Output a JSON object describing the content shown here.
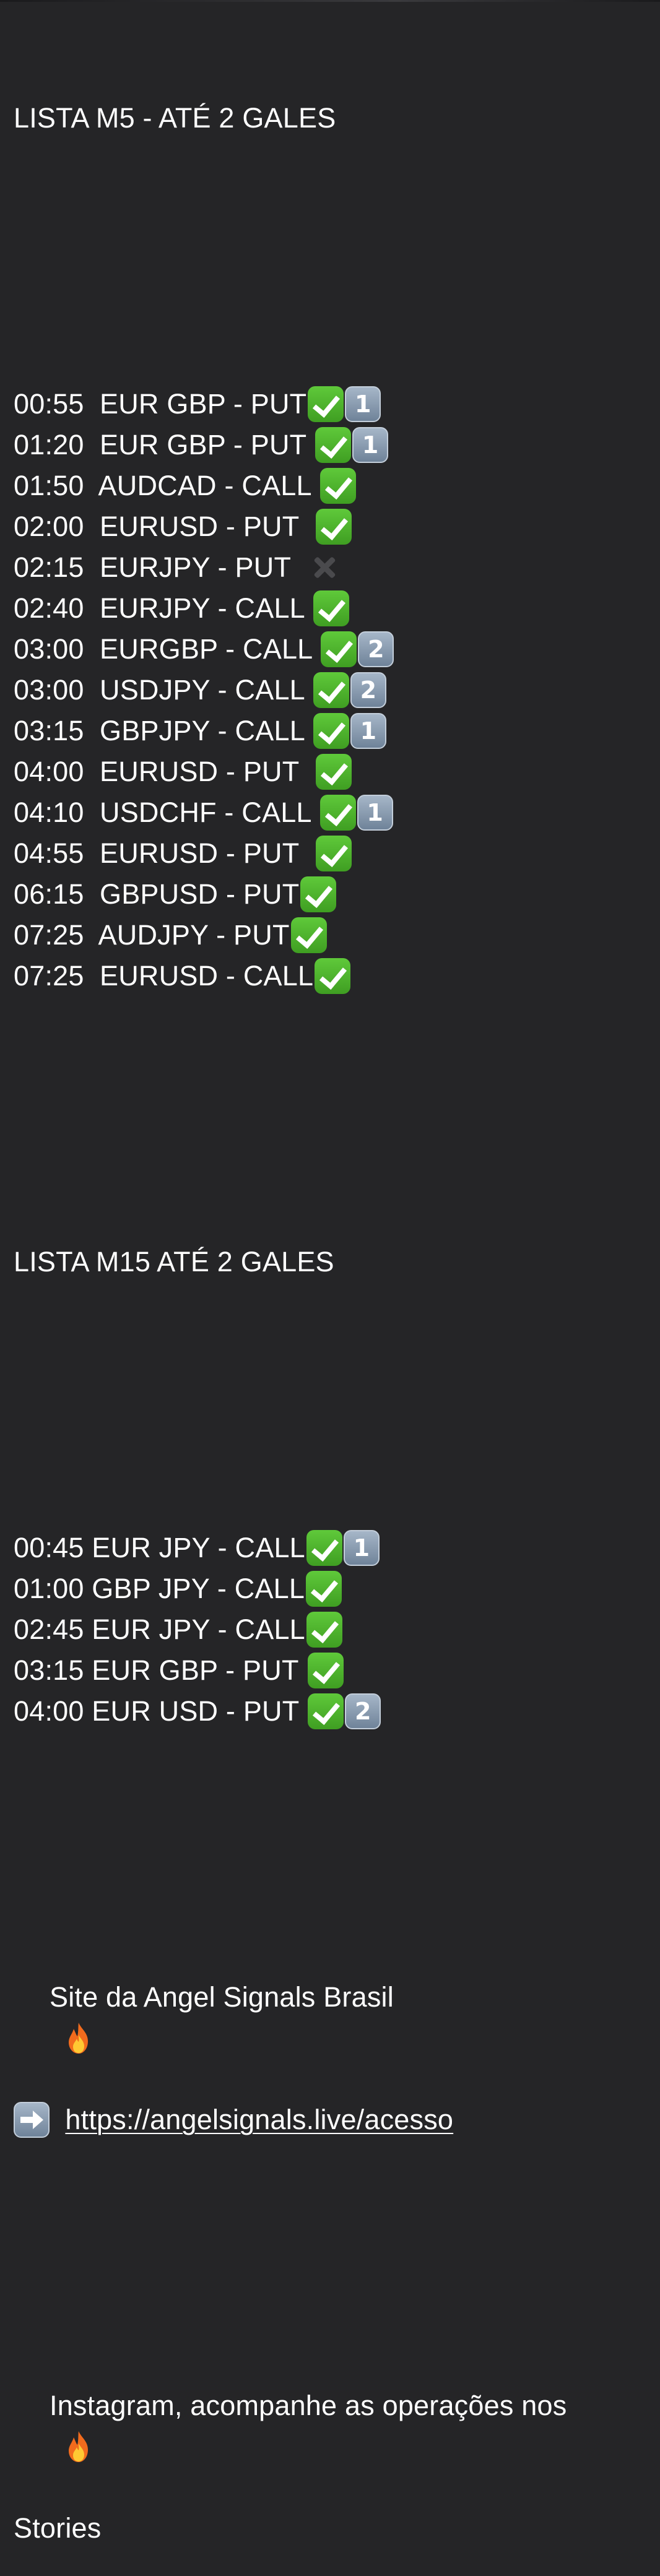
{
  "message": {
    "m5_title": "LISTA M5 - ATÉ 2 GALES",
    "m5_rows": [
      {
        "text": "00:55  EUR GBP - PUT",
        "result": "check",
        "gale": "1"
      },
      {
        "text": "01:20  EUR GBP - PUT ",
        "result": "check",
        "gale": "1"
      },
      {
        "text": "01:50  AUDCAD - CALL ",
        "result": "check",
        "gale": ""
      },
      {
        "text": "02:00  EURUSD - PUT  ",
        "result": "check",
        "gale": ""
      },
      {
        "text": "02:15  EURJPY - PUT  ",
        "result": "cross",
        "gale": ""
      },
      {
        "text": "02:40  EURJPY - CALL ",
        "result": "check",
        "gale": ""
      },
      {
        "text": "03:00  EURGBP - CALL ",
        "result": "check",
        "gale": "2"
      },
      {
        "text": "03:00  USDJPY - CALL ",
        "result": "check",
        "gale": "2"
      },
      {
        "text": "03:15  GBPJPY - CALL ",
        "result": "check",
        "gale": "1"
      },
      {
        "text": "04:00  EURUSD - PUT  ",
        "result": "check",
        "gale": ""
      },
      {
        "text": "04:10  USDCHF - CALL ",
        "result": "check",
        "gale": "1"
      },
      {
        "text": "04:55  EURUSD - PUT  ",
        "result": "check",
        "gale": ""
      },
      {
        "text": "06:15  GBPUSD - PUT",
        "result": "check",
        "gale": ""
      },
      {
        "text": "07:25  AUDJPY - PUT",
        "result": "check",
        "gale": ""
      },
      {
        "text": "07:25  EURUSD - CALL",
        "result": "check",
        "gale": ""
      }
    ],
    "m15_title": "LISTA M15 ATÉ 2 GALES",
    "m15_rows": [
      {
        "text": "00:45 EUR JPY - CALL",
        "result": "check",
        "gale": "1"
      },
      {
        "text": "01:00 GBP JPY - CALL",
        "result": "check",
        "gale": ""
      },
      {
        "text": "02:45 EUR JPY - CALL",
        "result": "check",
        "gale": ""
      },
      {
        "text": "03:15 EUR GBP - PUT ",
        "result": "check",
        "gale": ""
      },
      {
        "text": "04:00 EUR USD - PUT ",
        "result": "check",
        "gale": "2"
      }
    ],
    "site_label": "Site da Angel Signals Brasil",
    "site_link": "https://angelsignals.live/acesso",
    "instagram_line1": "Instagram, acompanhe as operações nos",
    "instagram_line2": "Stories"
  },
  "icons": {
    "result_check": "check-mark-button-icon",
    "result_cross": "cross-mark-icon",
    "gale_number": "keycap-number-icon",
    "fire": "fire-icon",
    "arrow": "right-arrow-icon"
  },
  "colors": {
    "background": "#252527",
    "text": "#ffffff",
    "check_green": "#4caf2e",
    "keycap_blue_gray": "#8a9bb0",
    "cross_gray": "#4a4a4d"
  }
}
